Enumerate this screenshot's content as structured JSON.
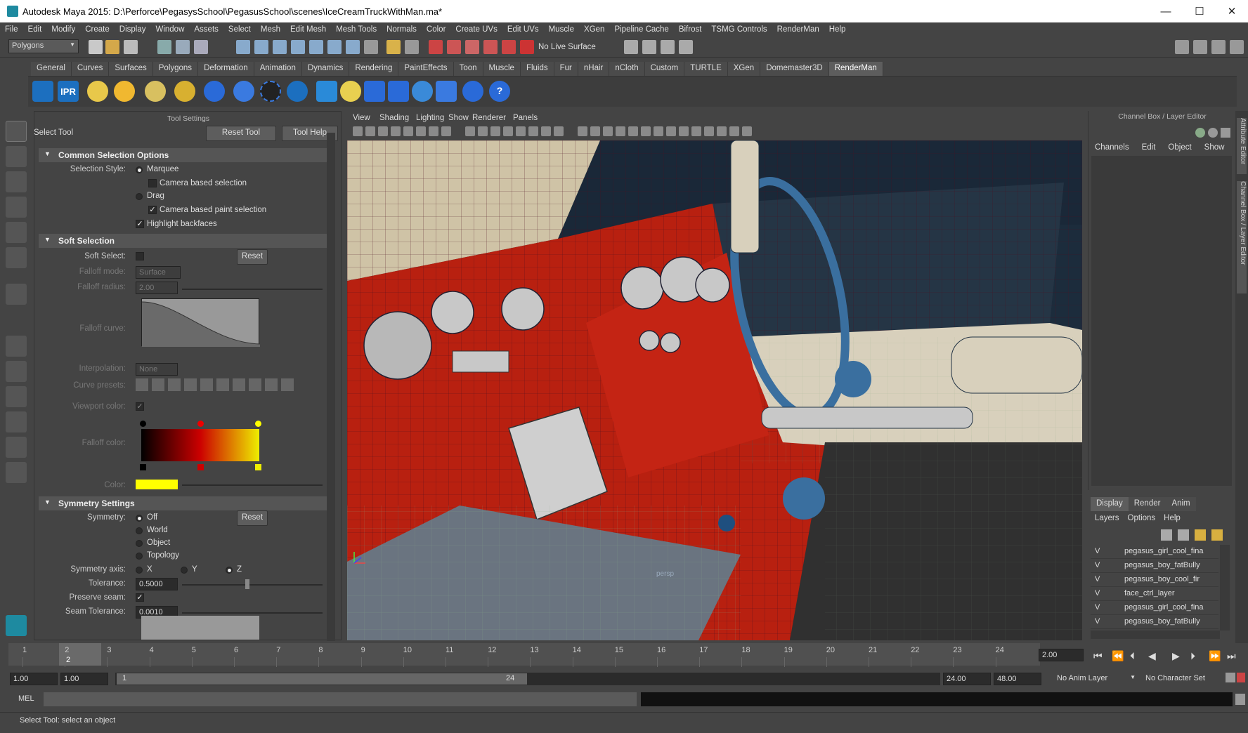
{
  "window": {
    "title": "Autodesk Maya 2015: D:\\Perforce\\PegasysSchool\\PegasusSchool\\scenes\\IceCreamTruckWithMan.ma*"
  },
  "menubar": [
    "File",
    "Edit",
    "Modify",
    "Create",
    "Display",
    "Window",
    "Assets",
    "Select",
    "Mesh",
    "Edit Mesh",
    "Mesh Tools",
    "Normals",
    "Color",
    "Create UVs",
    "Edit UVs",
    "Muscle",
    "XGen",
    "Pipeline Cache",
    "Bifrost",
    "TSMG Controls",
    "RenderMan",
    "Help"
  ],
  "statusline": {
    "mode": "Polygons",
    "live_surface": "No Live Surface"
  },
  "shelf": {
    "tabs": [
      "General",
      "Curves",
      "Surfaces",
      "Polygons",
      "Deformation",
      "Animation",
      "Dynamics",
      "Rendering",
      "PaintEffects",
      "Toon",
      "Muscle",
      "Fluids",
      "Fur",
      "nHair",
      "nCloth",
      "Custom",
      "TURTLE",
      "XGen",
      "Domemaster3D",
      "RenderMan"
    ],
    "active": "RenderMan",
    "ipr_label": "IPR"
  },
  "tool_settings": {
    "header": "Tool Settings",
    "tool_name": "Select Tool",
    "reset_tool": "Reset Tool",
    "tool_help": "Tool Help",
    "common": {
      "title": "Common Selection Options",
      "selection_style_label": "Selection Style:",
      "marquee": "Marquee",
      "camera_based_selection": "Camera based selection",
      "drag": "Drag",
      "camera_based_paint": "Camera based paint selection",
      "highlight_backfaces": "Highlight backfaces"
    },
    "soft": {
      "title": "Soft Selection",
      "soft_select_label": "Soft Select:",
      "reset": "Reset",
      "falloff_mode_label": "Falloff mode:",
      "falloff_mode_value": "Surface",
      "falloff_radius_label": "Falloff radius:",
      "falloff_radius_value": "2.00",
      "falloff_curve_label": "Falloff curve:",
      "interpolation_label": "Interpolation:",
      "interpolation_value": "None",
      "curve_presets_label": "Curve presets:",
      "viewport_color_label": "Viewport color:",
      "falloff_color_label": "Falloff color:",
      "color_label": "Color:",
      "color_swatch": "#ffff00"
    },
    "symmetry": {
      "title": "Symmetry Settings",
      "symmetry_label": "Symmetry:",
      "off": "Off",
      "world": "World",
      "object": "Object",
      "topology": "Topology",
      "reset": "Reset",
      "axis_label": "Symmetry axis:",
      "x": "X",
      "y": "Y",
      "z": "Z",
      "tolerance_label": "Tolerance:",
      "tolerance_value": "0.5000",
      "preserve_seam_label": "Preserve seam:",
      "seam_tolerance_label": "Seam Tolerance:",
      "seam_tolerance_value": "0.0010"
    }
  },
  "viewport": {
    "menus": [
      "View",
      "Shading",
      "Lighting",
      "Show",
      "Renderer",
      "Panels"
    ],
    "camera_label": "persp"
  },
  "channel_box": {
    "title": "Channel Box / Layer Editor",
    "menus": [
      "Channels",
      "Edit",
      "Object",
      "Show"
    ]
  },
  "layer_editor": {
    "tabs": [
      "Display",
      "Render",
      "Anim"
    ],
    "menus": [
      "Layers",
      "Options",
      "Help"
    ],
    "layers": [
      {
        "v": "V",
        "name": "pegasus_girl_cool_fina"
      },
      {
        "v": "V",
        "name": "pegasus_boy_fatBully"
      },
      {
        "v": "V",
        "name": "pegasus_boy_cool_fir"
      },
      {
        "v": "V",
        "name": "face_ctrl_layer"
      },
      {
        "v": "V",
        "name": "pegasus_girl_cool_fina"
      },
      {
        "v": "V",
        "name": "pegasus_boy_fatBully"
      }
    ]
  },
  "side_tabs": [
    "Attribute Editor",
    "Channel Box / Layer Editor"
  ],
  "timeline": {
    "ticks": [
      "1",
      "2",
      "3",
      "4",
      "5",
      "6",
      "7",
      "8",
      "9",
      "10",
      "11",
      "12",
      "13",
      "14",
      "15",
      "16",
      "17",
      "18",
      "19",
      "20",
      "21",
      "22",
      "23",
      "24"
    ],
    "current_frame": "2",
    "current_time_field": "2.00"
  },
  "range": {
    "start": "1.00",
    "start2": "1.00",
    "range_start": "1",
    "range_end": "24",
    "end": "24.00",
    "end2": "48.00",
    "anim_layer": "No Anim Layer",
    "character_set": "No Character Set"
  },
  "cmdline": {
    "label": "MEL"
  },
  "helpline": {
    "text": "Select Tool: select an object"
  }
}
